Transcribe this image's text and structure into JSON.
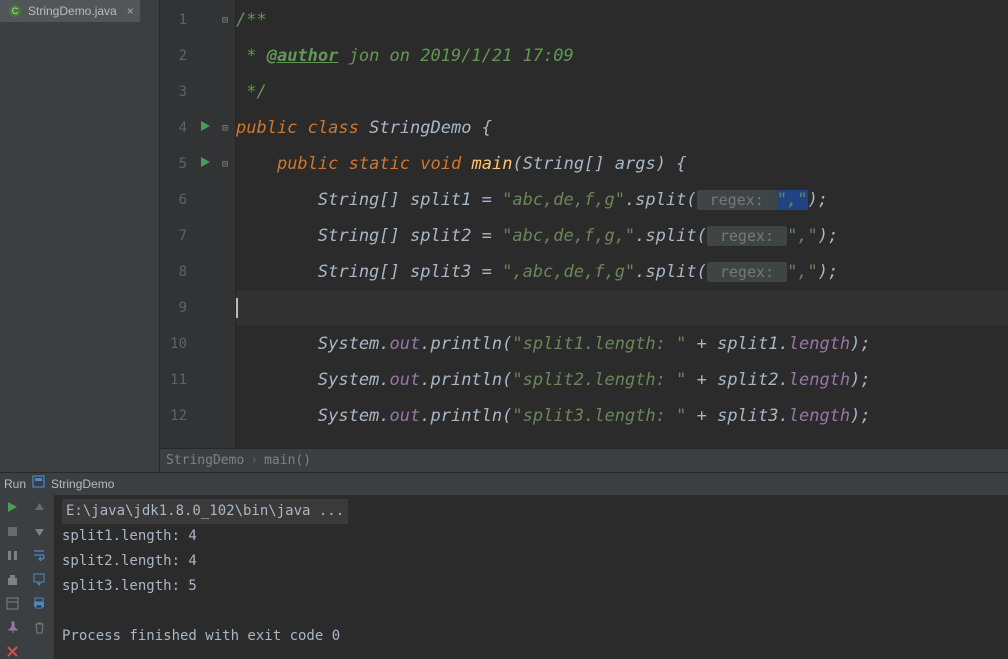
{
  "tab": {
    "filename": "StringDemo.java"
  },
  "breadcrumb": {
    "class": "StringDemo",
    "method": "main()"
  },
  "code": {
    "l1": "/**",
    "l2_star": " * ",
    "l2_tag": "@author",
    "l2_rest": " jon on 2019/1/21 17:09",
    "l3": " */",
    "l4_kw1": "public",
    "l4_kw2": "class",
    "l4_cls": "StringDemo",
    "l5_kw1": "public",
    "l5_kw2": "static",
    "l5_kw3": "void",
    "l5_mtd": "main",
    "l5_args": "(String[] args) {",
    "l6_a": "        String[] split1 = ",
    "l6_str": "\"abc,de,f,g\"",
    "l6_b": ".split(",
    "hint": " regex: ",
    "l6_arg": "\",\"",
    "l6_c": ");",
    "l7_a": "        String[] split2 = ",
    "l7_str": "\"abc,de,f,g,\"",
    "l7_b": ".split(",
    "l7_arg": "\",\"",
    "l7_c": ");",
    "l8_a": "        String[] split3 = ",
    "l8_str": "\",abc,de,f,g\"",
    "l8_b": ".split(",
    "l8_arg": "\",\"",
    "l8_c": ");",
    "l10_a": "        System.",
    "l10_field": "out",
    "l10_b": ".println(",
    "l10_str": "\"split1.length: \"",
    "l10_c": " + split1.",
    "l10_field2": "length",
    "l10_d": ");",
    "l11_str": "\"split2.length: \"",
    "l11_c": " + split2.",
    "l12_str": "\"split3.length: \"",
    "l12_c": " + split3."
  },
  "line_numbers": [
    "1",
    "2",
    "3",
    "4",
    "5",
    "6",
    "7",
    "8",
    "9",
    "10",
    "11",
    "12"
  ],
  "run": {
    "label": "Run",
    "config": "StringDemo",
    "cmd": "E:\\java\\jdk1.8.0_102\\bin\\java ...",
    "out1": "split1.length: 4",
    "out2": "split2.length: 4",
    "out3": "split3.length: 5",
    "exit": "Process finished with exit code 0"
  }
}
